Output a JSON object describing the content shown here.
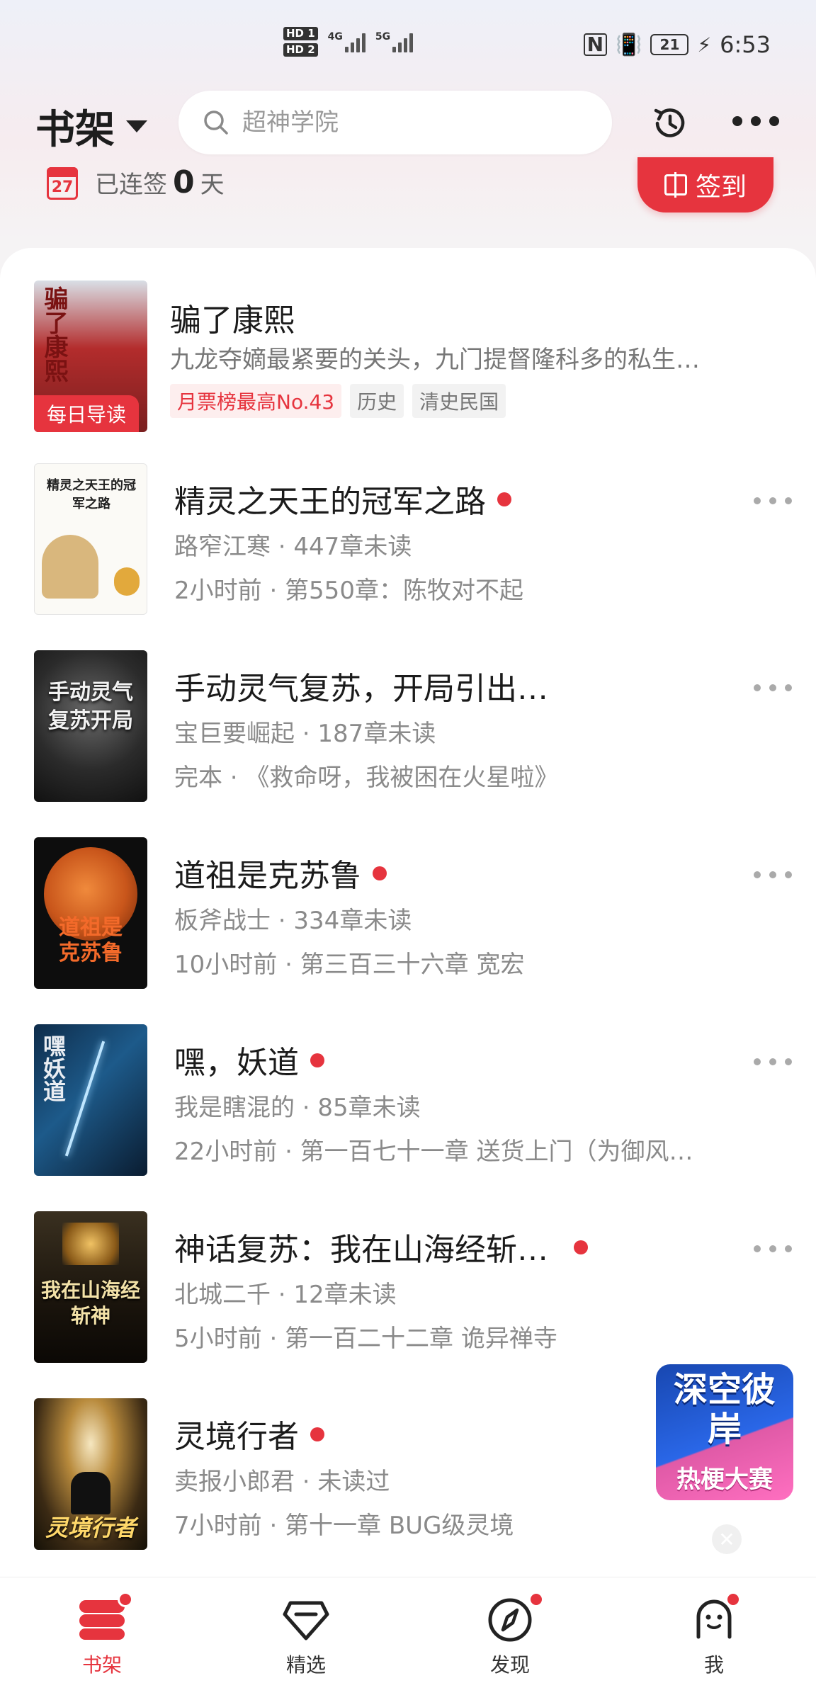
{
  "status_bar": {
    "hd1": "HD 1",
    "hd2": "HD 2",
    "net1": "4G",
    "net2": "5G",
    "battery": "21",
    "time": "6:53"
  },
  "header": {
    "title": "书架",
    "search_placeholder": "超神学院"
  },
  "checkin": {
    "calendar_day": "27",
    "prefix": "已连签",
    "count": "0",
    "suffix": "天",
    "button_label": "签到"
  },
  "books": [
    {
      "title": "骗了康熙",
      "line1": "九龙夺嫡最紧要的关头，九门提督隆科多的私生…",
      "tags": [
        "月票榜最高No.43",
        "历史",
        "清史民国"
      ],
      "badge": "每日导读",
      "cover_text": "骗了康熙",
      "has_dot": false
    },
    {
      "title": "精灵之天王的冠军之路",
      "line1": "路窄江寒 · 447章未读",
      "line2": "2小时前 · 第550章：陈牧对不起",
      "cover_text": "精灵之天王的冠军之路",
      "has_dot": true
    },
    {
      "title": "手动灵气复苏，开局引出…",
      "line1": "宝巨要崛起 · 187章未读",
      "line2": "完本 · 《救命呀，我被困在火星啦》",
      "cover_text": "手动灵气复苏开局",
      "has_dot": false
    },
    {
      "title": "道祖是克苏鲁",
      "line1": "板斧战士 · 334章未读",
      "line2": "10小时前 · 第三百三十六章 宽宏",
      "cover_text": "道祖是克苏鲁",
      "has_dot": true
    },
    {
      "title": "嘿，妖道",
      "line1": "我是瞎混的 · 85章未读",
      "line2": "22小时前 · 第一百七十一章 送货上门（为御风…",
      "cover_text": "嘿妖道",
      "has_dot": true
    },
    {
      "title": "神话复苏：我在山海经斩…",
      "line1": "北城二千 · 12章未读",
      "line2": "5小时前 · 第一百二十二章 诡异禅寺",
      "cover_text": "我在山海经斩神",
      "has_dot": true
    },
    {
      "title": "灵境行者",
      "line1": "卖报小郎君 · 未读过",
      "line2": "7小时前 · 第十一章 BUG级灵境",
      "cover_text": "灵境行者",
      "has_dot": true
    }
  ],
  "float_ad": {
    "line1": "深空彼岸",
    "line2": "热梗大赛"
  },
  "nav": [
    {
      "label": "书架",
      "icon": "bookshelf-icon",
      "active": true
    },
    {
      "label": "精选",
      "icon": "diamond-icon",
      "active": false
    },
    {
      "label": "发现",
      "icon": "compass-icon",
      "active": false
    },
    {
      "label": "我",
      "icon": "profile-icon",
      "active": false
    }
  ],
  "colors": {
    "accent": "#e6343e",
    "text_primary": "#1b1b1b",
    "text_secondary": "#8a8a8a"
  }
}
